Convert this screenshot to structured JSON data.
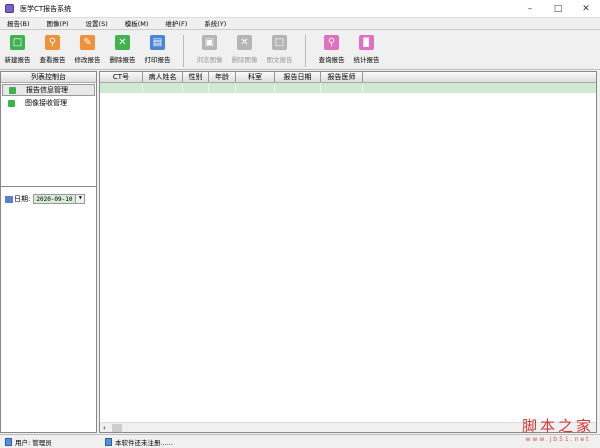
{
  "window": {
    "title": "医学CT报告系统"
  },
  "menu": [
    "报告(B)",
    "图像(P)",
    "设置(S)",
    "模板(M)",
    "维护(F)",
    "系统(Y)"
  ],
  "toolbar": [
    {
      "label": "新建报告",
      "icon": "new-report-icon",
      "color": "#3fb34f",
      "enabled": true
    },
    {
      "label": "查看报告",
      "icon": "view-report-icon",
      "color": "#f0913a",
      "enabled": true
    },
    {
      "label": "修改报告",
      "icon": "edit-report-icon",
      "color": "#f0913a",
      "enabled": true
    },
    {
      "label": "删除报告",
      "icon": "delete-report-icon",
      "color": "#3fb34f",
      "enabled": true
    },
    {
      "label": "打印报告",
      "icon": "print-report-icon",
      "color": "#4a86d8",
      "enabled": true
    },
    {
      "label": "浏览图像",
      "icon": "browse-image-icon",
      "enabled": false
    },
    {
      "label": "删除图像",
      "icon": "delete-image-icon",
      "enabled": false
    },
    {
      "label": "图文报告",
      "icon": "image-text-report-icon",
      "enabled": false
    },
    {
      "label": "查询报告",
      "icon": "search-report-icon",
      "color": "#e070c0",
      "enabled": true
    },
    {
      "label": "统计报告",
      "icon": "stats-report-icon",
      "color": "#e070c0",
      "enabled": true
    }
  ],
  "left_panel": {
    "title": "列表控制台",
    "items": [
      "报告信息管理",
      "图像接收管理"
    ],
    "date_label": "日期:",
    "date_value": "2020-09-10"
  },
  "grid": {
    "columns": [
      "CT号",
      "病人姓名",
      "性别",
      "年龄",
      "科室",
      "报告日期",
      "报告医师"
    ]
  },
  "status": {
    "user": "用户: 管理员",
    "registration": "本软件还未注册......"
  },
  "watermark": {
    "text": "脚本之家",
    "url": "www.jb51.net"
  }
}
